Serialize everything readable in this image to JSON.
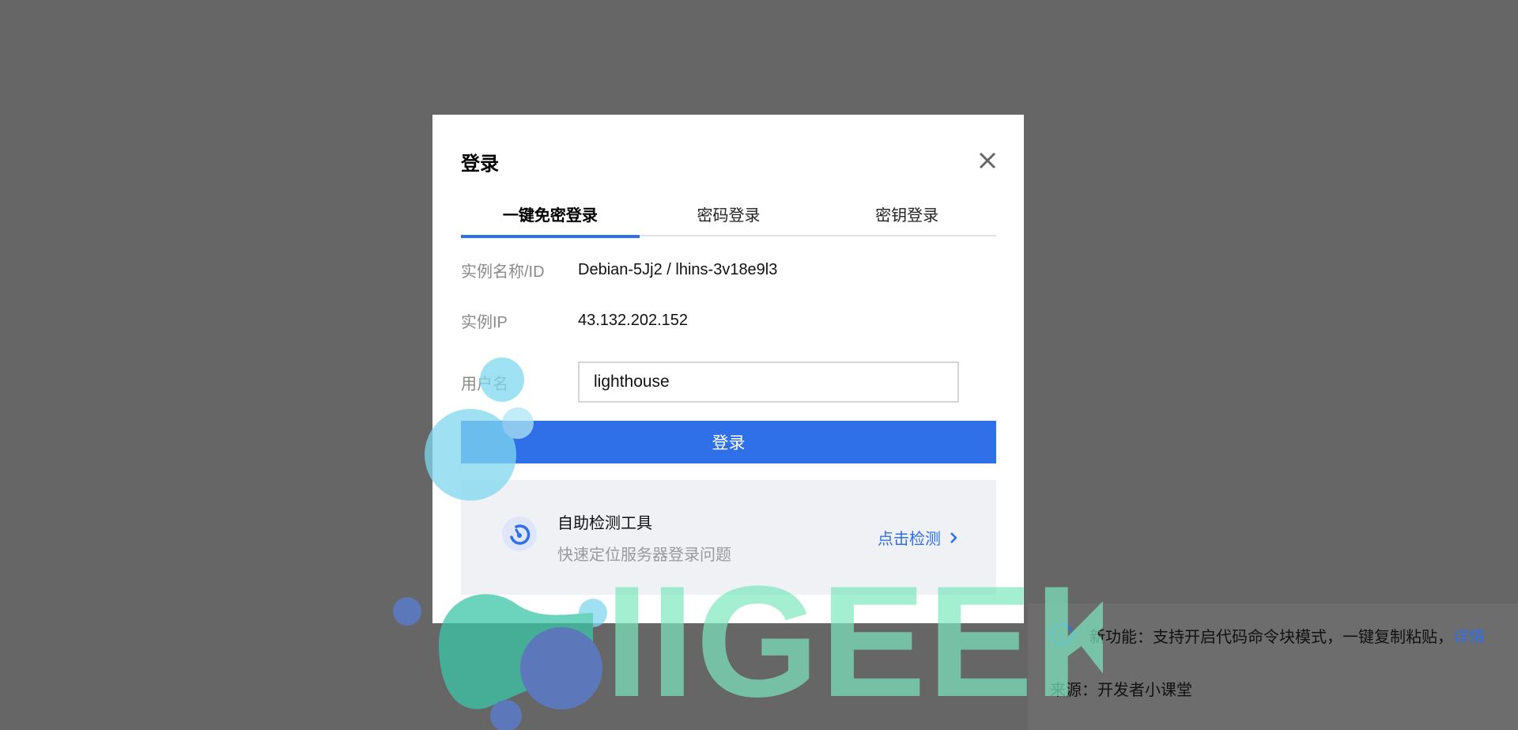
{
  "dialog": {
    "title": "登录",
    "tabs": [
      {
        "label": "一键免密登录",
        "active": true
      },
      {
        "label": "密码登录",
        "active": false
      },
      {
        "label": "密钥登录",
        "active": false
      }
    ],
    "instance_name_label": "实例名称/ID",
    "instance_name_value": "Debian-5Jj2 / lhins-3v18e9l3",
    "instance_ip_label": "实例IP",
    "instance_ip_value": "43.132.202.152",
    "username_label": "用户名",
    "username_value": "lighthouse",
    "login_button_label": "登录",
    "tool": {
      "title": "自助检测工具",
      "subtitle": "快速定位服务器登录问题",
      "link_label": "点击检测"
    }
  },
  "notification": {
    "text": "新功能：支持开启代码命令块模式，一键复制粘贴，",
    "link_label": "详情",
    "source": "来源：开发者小课堂"
  },
  "watermark": {
    "text": "IIGEEK"
  },
  "colors": {
    "accent": "#2f6fe8",
    "overlay": "#666666",
    "card_bg": "#f0f1f4",
    "watermark_green": "#7ee8c0",
    "watermark_teal": "#3cc6a8",
    "watermark_blue": "#5a7fd6"
  },
  "icons": {
    "close": "close-icon",
    "tool": "gauge-icon",
    "link": "chevron-right-icon",
    "info": "info-icon"
  }
}
